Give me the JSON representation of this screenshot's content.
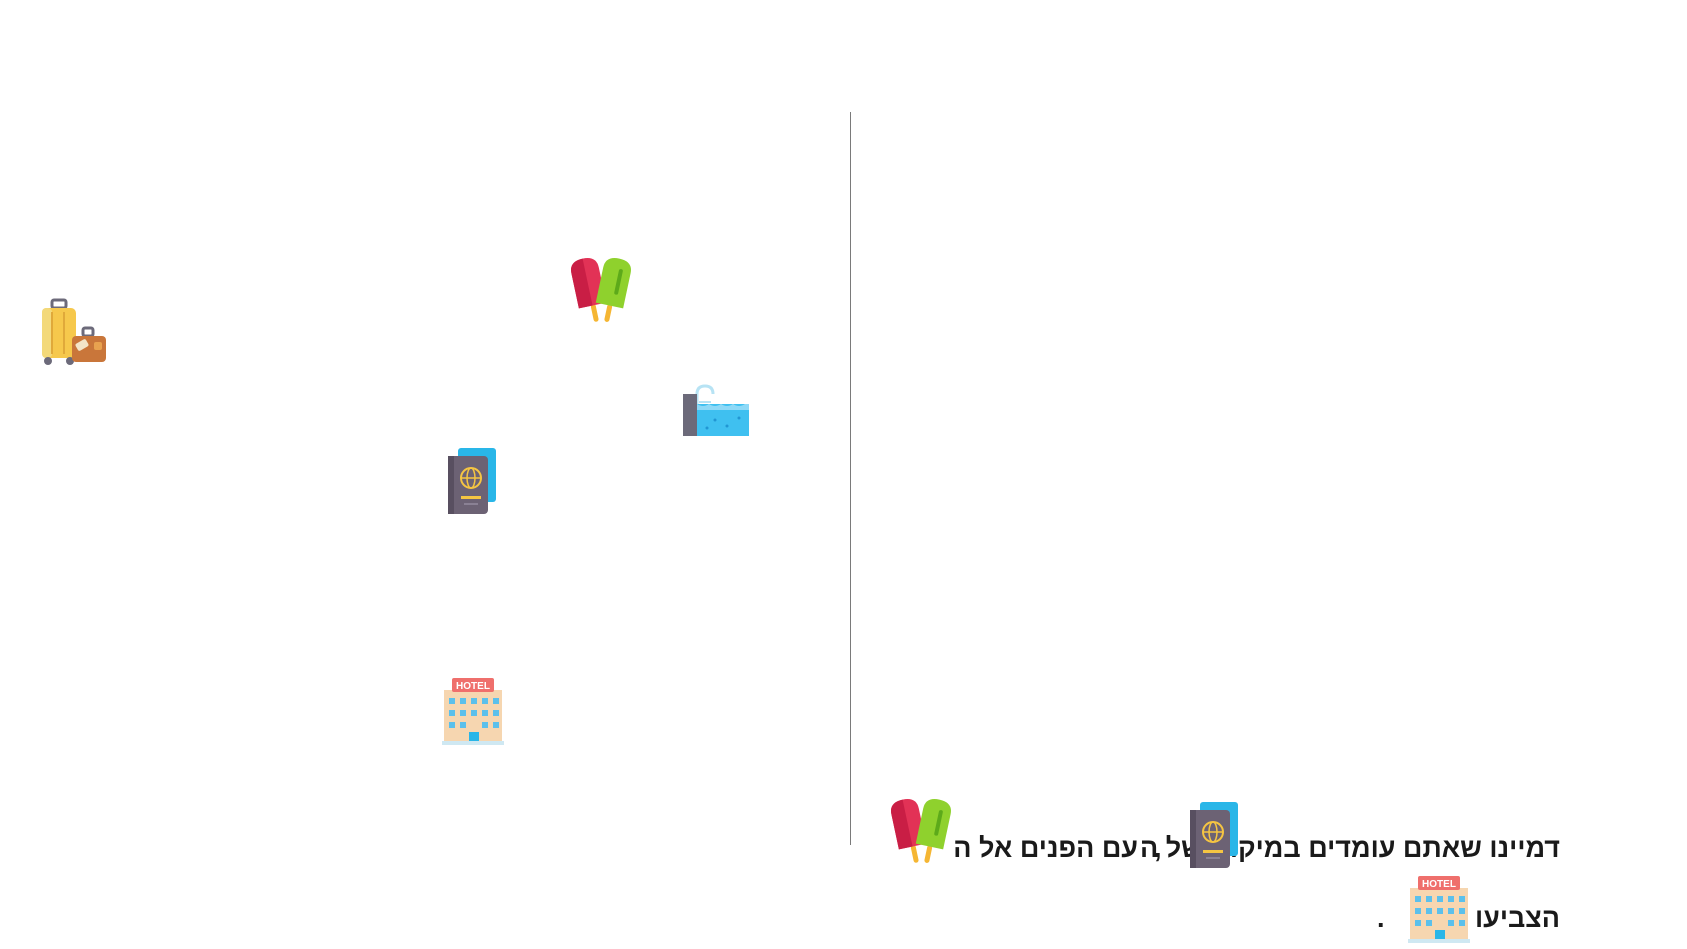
{
  "sentence": {
    "line1_part1": "דמיינו שאתם עומדים במיקום של ה",
    "comma": ",",
    "line1_part2": "עם הפנים אל ה",
    "line2_part1": "הצביעו אל ה",
    "period": "."
  },
  "icons": {
    "luggage": "luggage-icon",
    "popsicles": "popsicles-icon",
    "pool": "pool-icon",
    "passport": "passport-icon",
    "hotel": "hotel-icon"
  },
  "hotel_sign": "HOTEL",
  "colors": {
    "divider": "#7a7a7a",
    "text": "#1a1a1a"
  }
}
